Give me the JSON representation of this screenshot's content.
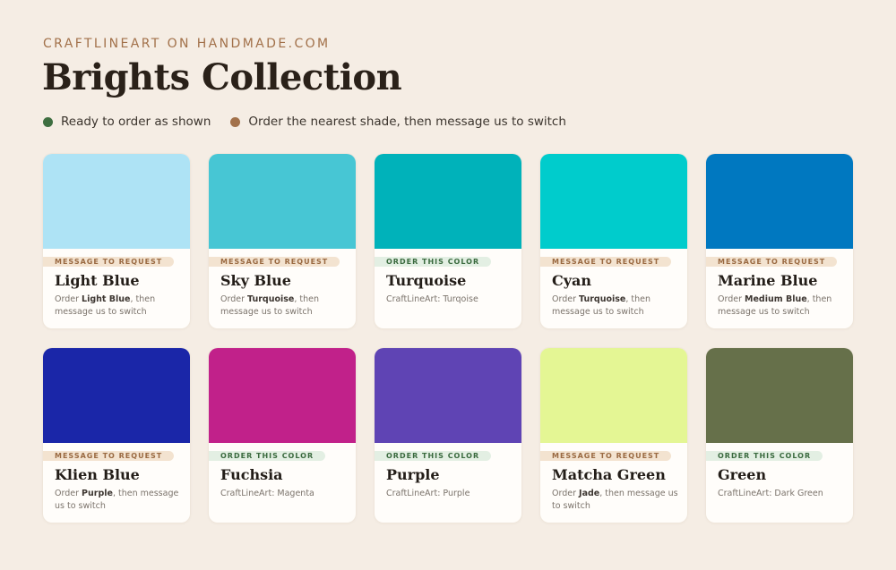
{
  "header": {
    "eyebrow": "CRAFTLINEART ON HANDMADE.COM",
    "title": "Brights Collection"
  },
  "legend": [
    {
      "label": "Ready to order as shown",
      "color": "#3e6e40"
    },
    {
      "label": "Order the nearest shade, then message us to switch",
      "color": "#a2714a"
    }
  ],
  "colors": {
    "order_badge": "#3a6a3e",
    "request_badge": "#9a6a42"
  },
  "cards": [
    {
      "name": "Light Blue",
      "swatch": "#aee3f5",
      "status": "request",
      "badge": "MESSAGE TO REQUEST",
      "note_prefix": "Order ",
      "note_bold": "Light Blue",
      "note_suffix": ", then message us to switch"
    },
    {
      "name": "Sky Blue",
      "swatch": "#47c6d4",
      "status": "request",
      "badge": "MESSAGE TO REQUEST",
      "note_prefix": "Order ",
      "note_bold": "Turquoise",
      "note_suffix": ", then message us to switch"
    },
    {
      "name": "Turquoise",
      "swatch": "#00b2ba",
      "status": "order",
      "badge": "ORDER THIS COLOR",
      "note_prefix": "CraftLineArt: Turqoise",
      "note_bold": "",
      "note_suffix": ""
    },
    {
      "name": "Cyan",
      "swatch": "#00cccc",
      "status": "request",
      "badge": "MESSAGE TO REQUEST",
      "note_prefix": "Order ",
      "note_bold": "Turquoise",
      "note_suffix": ", then message us to switch"
    },
    {
      "name": "Marine Blue",
      "swatch": "#0078c0",
      "status": "request",
      "badge": "MESSAGE TO REQUEST",
      "note_prefix": "Order ",
      "note_bold": "Medium Blue",
      "note_suffix": ", then message us to switch"
    },
    {
      "name": "Klien Blue",
      "swatch": "#1a26a8",
      "status": "request",
      "badge": "MESSAGE TO REQUEST",
      "note_prefix": "Order ",
      "note_bold": "Purple",
      "note_suffix": ", then message us to switch"
    },
    {
      "name": "Fuchsia",
      "swatch": "#c1218a",
      "status": "order",
      "badge": "ORDER THIS COLOR",
      "note_prefix": "CraftLineArt: Magenta",
      "note_bold": "",
      "note_suffix": ""
    },
    {
      "name": "Purple",
      "swatch": "#5f44b4",
      "status": "order",
      "badge": "ORDER THIS COLOR",
      "note_prefix": "CraftLineArt: Purple",
      "note_bold": "",
      "note_suffix": ""
    },
    {
      "name": "Matcha Green",
      "swatch": "#e4f694",
      "status": "request",
      "badge": "MESSAGE TO REQUEST",
      "note_prefix": "Order ",
      "note_bold": "Jade",
      "note_suffix": ", then message us to switch"
    },
    {
      "name": "Green",
      "swatch": "#66704a",
      "status": "order",
      "badge": "ORDER THIS COLOR",
      "note_prefix": "CraftLineArt: Dark Green",
      "note_bold": "",
      "note_suffix": ""
    }
  ]
}
